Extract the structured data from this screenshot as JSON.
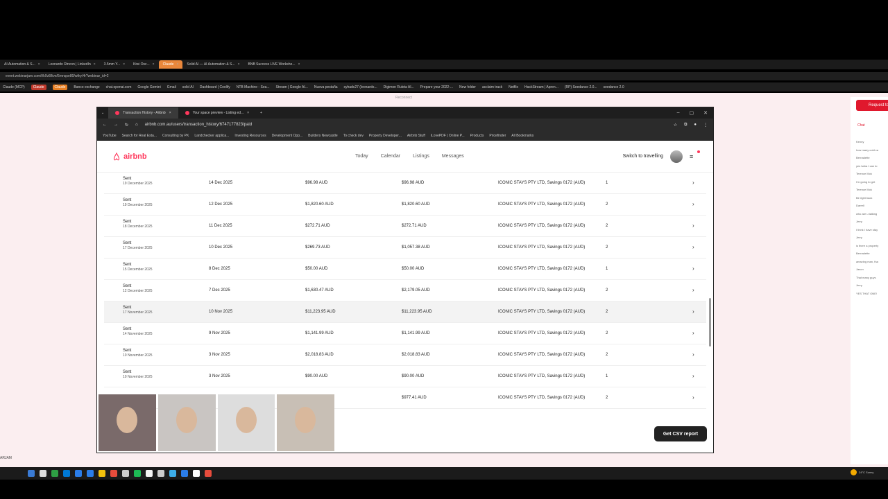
{
  "outer_browser": {
    "tabs": [
      {
        "label": "AI Automation & S...",
        "active": false
      },
      {
        "label": "Leonardo Rincon | LinkedIn",
        "active": false
      },
      {
        "label": "3.5mm Y...",
        "active": false
      },
      {
        "label": "Kiwi Osc...",
        "active": false
      },
      {
        "label": "Claude",
        "active": true
      },
      {
        "label": "Solid AI — AI Automation & S...",
        "active": false
      },
      {
        "label": "BNB Success LIVE Worksho...",
        "active": false
      }
    ],
    "url": "event.webinarjam.com/t/k0v8/live/5mnqxe80/wthy/4r?webinar_id=2",
    "bookmarks": [
      "Claude (MCP)",
      "Claude",
      "Claude",
      "Banco exchange",
      "chat.openai.com",
      "Google Gemini",
      "Gmail",
      "solid AI",
      "Dashboard | Coolify",
      "NTB Machine - Sea...",
      "Stream | Google AI...",
      "Nueva pestaña",
      "syhadc27 (leonardo...",
      "Digimon Ruleta AI...",
      "Prepare your 2022-...",
      "New folder",
      "acclaim track",
      "Netflix",
      "HackStream | Apren...",
      "(RP) Seedance 2.0...",
      "seedance 2.0"
    ],
    "reconnect": "Reconnect"
  },
  "inner_browser": {
    "tabs": [
      {
        "label": "Transaction History - Airbnb",
        "active": true
      },
      {
        "label": "Your space preview - Listing ed...",
        "active": false
      }
    ],
    "url": "airbnb.com.au/users/transaction_history/6747177823/paid",
    "bookmarks": [
      "YouTube",
      "Search for Real Esta...",
      "Consulting by PK",
      "Landchecker applica...",
      "Investing Resources",
      "Development Opp...",
      "Builders Newcastle",
      "To check dev",
      "Property Developer...",
      "Airbnb Stuff",
      "iLovePDF | Online P...",
      "Products",
      "Pricefinder",
      "All Bookmarks"
    ]
  },
  "airbnb": {
    "brand": "airbnb",
    "nav": [
      "Today",
      "Calendar",
      "Listings",
      "Messages"
    ],
    "switch": "Switch to travelling",
    "csv_button": "Get CSV report",
    "rows": [
      {
        "status": "Sent",
        "sent_date": "19 December 2025",
        "date": "14 Dec 2025",
        "amount": "$96.98 AUD",
        "paid": "$96.98 AUD",
        "account": "ICONIC STAYS PTY LTD, Savings 0172 (AUD)",
        "count": "1"
      },
      {
        "status": "Sent",
        "sent_date": "19 December 2025",
        "date": "12 Dec 2025",
        "amount": "$1,820.60 AUD",
        "paid": "$1,820.60 AUD",
        "account": "ICONIC STAYS PTY LTD, Savings 0172 (AUD)",
        "count": "2"
      },
      {
        "status": "Sent",
        "sent_date": "18 December 2025",
        "date": "11 Dec 2025",
        "amount": "$272.71 AUD",
        "paid": "$272.71 AUD",
        "account": "ICONIC STAYS PTY LTD, Savings 0172 (AUD)",
        "count": "2"
      },
      {
        "status": "Sent",
        "sent_date": "17 December 2025",
        "date": "10 Dec 2025",
        "amount": "$269.73 AUD",
        "paid": "$1,057.38 AUD",
        "account": "ICONIC STAYS PTY LTD, Savings 0172 (AUD)",
        "count": "2"
      },
      {
        "status": "Sent",
        "sent_date": "15 December 2025",
        "date": "8 Dec 2025",
        "amount": "$50.00 AUD",
        "paid": "$50.00 AUD",
        "account": "ICONIC STAYS PTY LTD, Savings 0172 (AUD)",
        "count": "1"
      },
      {
        "status": "Sent",
        "sent_date": "12 December 2025",
        "date": "7 Dec 2025",
        "amount": "$1,630.47 AUD",
        "paid": "$2,179.05 AUD",
        "account": "ICONIC STAYS PTY LTD, Savings 0172 (AUD)",
        "count": "2"
      },
      {
        "status": "Sent",
        "sent_date": "17 November 2025",
        "date": "10 Nov 2025",
        "amount": "$11,223.95 AUD",
        "paid": "$11,223.95 AUD",
        "account": "ICONIC STAYS PTY LTD, Savings 0172 (AUD)",
        "count": "2"
      },
      {
        "status": "Sent",
        "sent_date": "14 November 2025",
        "date": "9 Nov 2025",
        "amount": "$1,141.99 AUD",
        "paid": "$1,141.99 AUD",
        "account": "ICONIC STAYS PTY LTD, Savings 0172 (AUD)",
        "count": "2"
      },
      {
        "status": "Sent",
        "sent_date": "10 November 2025",
        "date": "3 Nov 2025",
        "amount": "$2,018.83 AUD",
        "paid": "$2,018.83 AUD",
        "account": "ICONIC STAYS PTY LTD, Savings 0172 (AUD)",
        "count": "2"
      },
      {
        "status": "Sent",
        "sent_date": "10 November 2025",
        "date": "3 Nov 2025",
        "amount": "$90.00 AUD",
        "paid": "$90.00 AUD",
        "account": "ICONIC STAYS PTY LTD, Savings 0172 (AUD)",
        "count": "1"
      },
      {
        "status": "",
        "sent_date": "",
        "date": "",
        "amount": "",
        "paid": "$977.41 AUD",
        "account": "ICONIC STAYS PTY LTD, Savings 0172 (AUD)",
        "count": "2"
      }
    ]
  },
  "side_panel": {
    "request": "Request to",
    "chat": "Chat",
    "messages": [
      "Kenny",
      "how many cold ca",
      "Bernadette",
      "yes haha I can to",
      "Terence Mok",
      "I'm going to get",
      "Terence Mok",
      "Be right back",
      "Darrell",
      "who are u talking",
      "Jerry",
      "I think I have stay",
      "Jerry",
      "is there a property",
      "Bernadette",
      "amazing man, tha",
      "Jason",
      "That many guys",
      "Jerry",
      "YES THAT ONE!"
    ]
  },
  "taskbar": {
    "user": "ARJAM",
    "weather": "24°C Sunny"
  },
  "colors": {
    "brand": "#ff385c",
    "request": "#e0182d",
    "active_tab": "#e9873b"
  }
}
